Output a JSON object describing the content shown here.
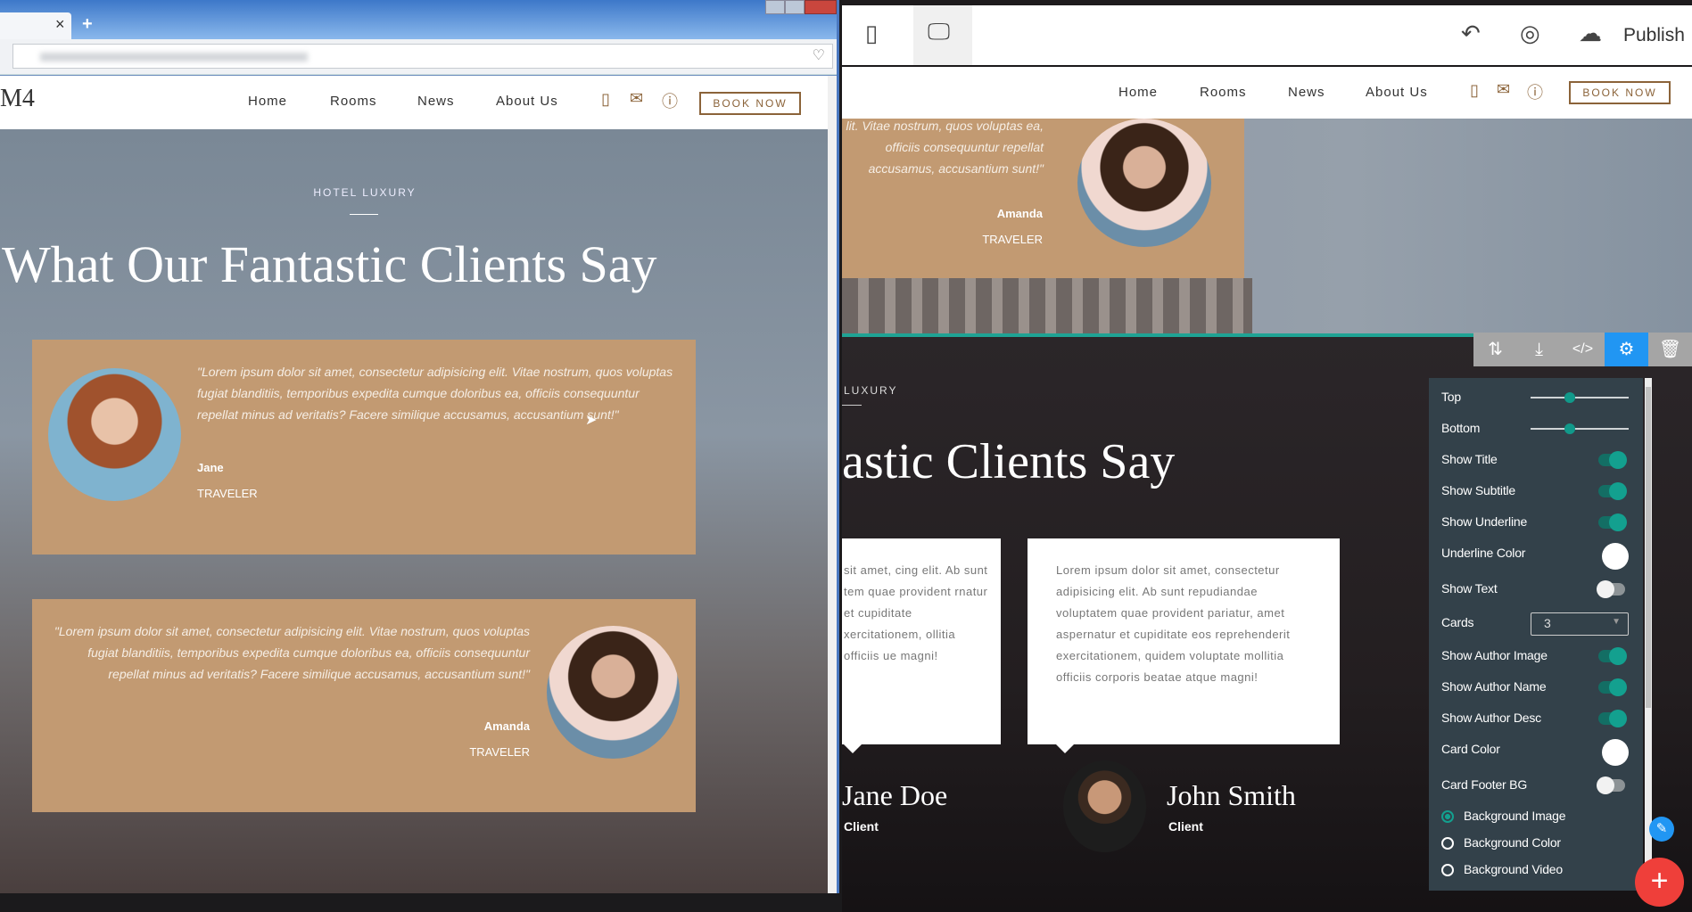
{
  "browser": {
    "tab_close": "×",
    "new_tab": "+",
    "window_controls": [
      "minimize",
      "maximize",
      "close"
    ]
  },
  "site": {
    "logo": "M4",
    "nav": [
      "Home",
      "Rooms",
      "News",
      "About Us"
    ],
    "nav_icons": [
      "phone-icon",
      "mail-icon",
      "help-icon"
    ],
    "book_now": "BOOK NOW"
  },
  "left_section": {
    "subtitle": "HOTEL LUXURY",
    "title": "What Our Fantastic Clients Say",
    "cards": [
      {
        "quote": "\"Lorem ipsum dolor sit amet, consectetur adipisicing elit. Vitae nostrum, quos voluptas fugiat blanditiis, temporibus expedita cumque doloribus ea, officiis consequuntur repellat minus ad veritatis? Facere similique accusamus, accusantium sunt!\"",
        "name": "Jane",
        "role": "TRAVELER"
      },
      {
        "quote": "\"Lorem ipsum dolor sit amet, consectetur adipisicing elit. Vitae nostrum, quos voluptas fugiat blanditiis, temporibus expedita cumque doloribus ea, officiis consequuntur repellat minus ad veritatis? Facere similique accusamus, accusantium sunt!\"",
        "name": "Amanda",
        "role": "TRAVELER"
      }
    ],
    "card_color": "#c29a72"
  },
  "editor": {
    "publish": "Publish",
    "toolbar_icons": [
      "tablet-icon",
      "desktop-icon",
      "undo-icon",
      "preview-eye-icon",
      "cloud-upload-icon"
    ],
    "partial_card": {
      "quote": "lit. Vitae nostrum, quos voluptas ea, officiis consequuntur repellat accusamus, accusantium sunt!\"",
      "name": "Amanda",
      "role": "TRAVELER"
    },
    "section": {
      "subtitle": "LUXURY",
      "title": "astic Clients Say",
      "cards": [
        {
          "text": "sit amet, cing elit. Ab sunt tem quae provident rnatur et cupiditate xercitationem, ollitia officiis ue magni!",
          "name": "Jane Doe",
          "role": "Client"
        },
        {
          "text": "Lorem ipsum dolor sit amet, consectetur adipisicing elit. Ab sunt repudiandae voluptatem quae provident pariatur, amet aspernatur et cupiditate eos reprehenderit exercitationem, quidem voluptate mollitia officiis corporis beatae atque magni!",
          "name": "John Smith",
          "role": "Client"
        }
      ]
    },
    "section_tools": [
      "move-icon",
      "download-icon",
      "code-icon",
      "gear-icon",
      "trash-icon"
    ],
    "accent": "#1fa394",
    "settings": {
      "top_label": "Top",
      "top_value": 0.4,
      "bottom_label": "Bottom",
      "bottom_value": 0.4,
      "toggles": [
        {
          "label": "Show Title",
          "on": true
        },
        {
          "label": "Show Subtitle",
          "on": true
        },
        {
          "label": "Show Underline",
          "on": true
        }
      ],
      "underline_color_label": "Underline Color",
      "underline_color": "#ffffff",
      "show_text_label": "Show Text",
      "show_text": false,
      "cards_label": "Cards",
      "cards_value": "3",
      "toggles2": [
        {
          "label": "Show Author Image",
          "on": true
        },
        {
          "label": "Show Author Name",
          "on": true
        },
        {
          "label": "Show Author Desc",
          "on": true
        }
      ],
      "card_color_label": "Card Color",
      "card_color": "#ffffff",
      "card_footer_label": "Card Footer BG",
      "card_footer": false,
      "background_options": [
        "Background Image",
        "Background Color",
        "Background Video"
      ],
      "background_selected": "Background Image"
    },
    "fab": "+"
  }
}
